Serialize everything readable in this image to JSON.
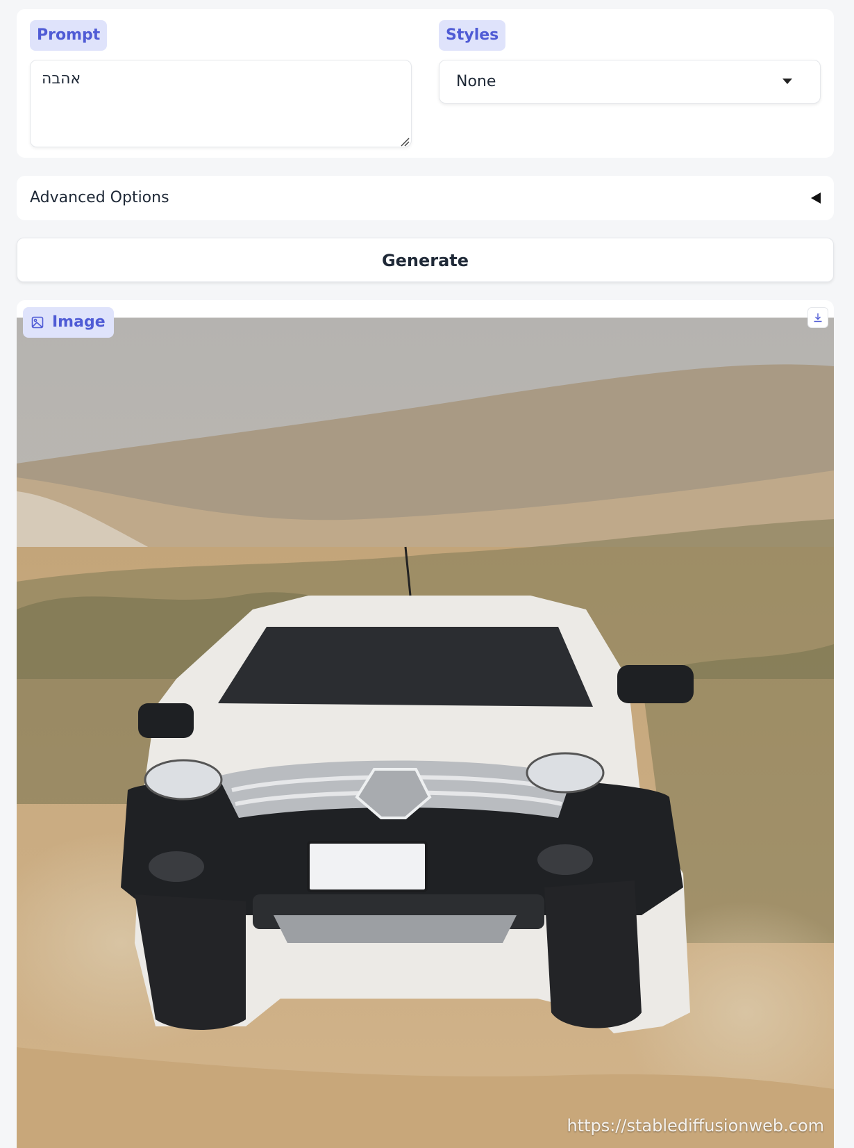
{
  "prompt": {
    "label": "Prompt",
    "value": "אהבה"
  },
  "styles": {
    "label": "Styles",
    "selected": "None"
  },
  "advanced": {
    "label": "Advanced Options"
  },
  "generate": {
    "label": "Generate"
  },
  "output": {
    "label": "Image",
    "watermark": "https://stablediffusionweb.com"
  },
  "colors": {
    "accent": "#4f5bd5",
    "chip_bg": "#dfe3fb",
    "page_bg": "#f5f6f8"
  },
  "icons": [
    "image-icon",
    "download-icon",
    "chevron-down-icon",
    "collapse-arrow-icon",
    "resize-handle-icon"
  ]
}
